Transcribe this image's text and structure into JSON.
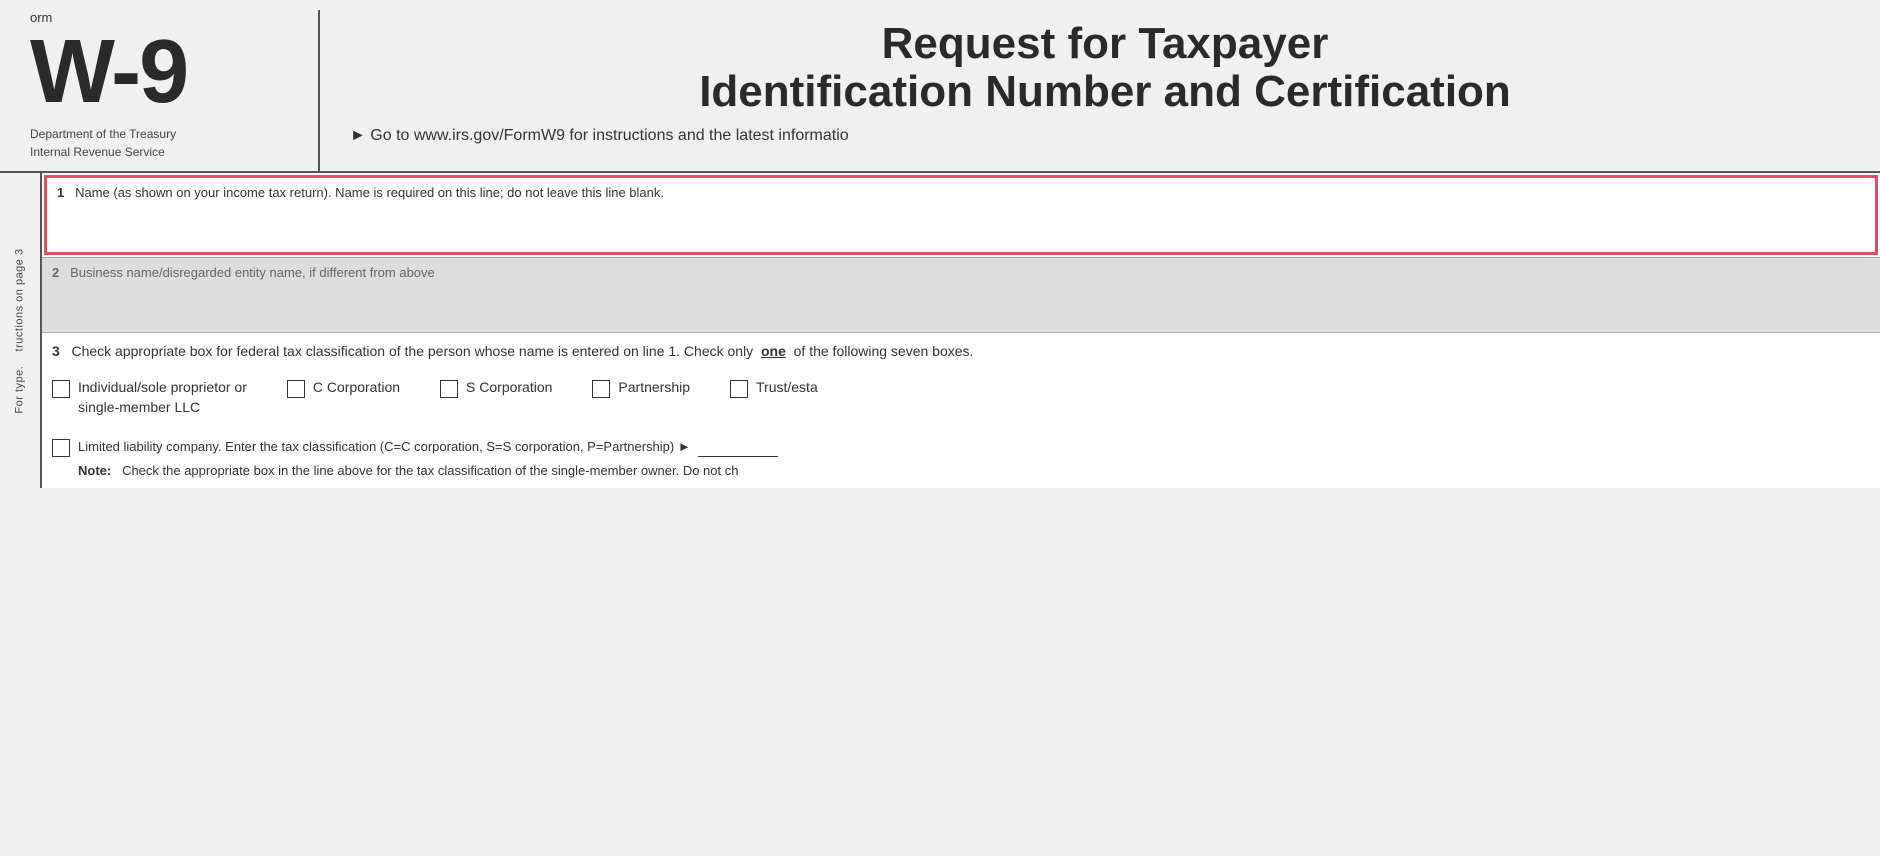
{
  "header": {
    "form_label": "orm",
    "form_number": "W-9",
    "dept_line1": "Department of the Treasury",
    "dept_line2": "Internal Revenue Service",
    "title_line1": "Request for Taxpayer",
    "title_line2": "Identification Number and Certification",
    "instruction": "► Go to www.irs.gov/FormW9 for instructions and the latest informatio"
  },
  "side_labels": {
    "line1": "For type.",
    "line2": "tructions on page 3"
  },
  "fields": {
    "field1": {
      "number": "1",
      "label": "Name (as shown on your income tax return). Name is required on this line; do not leave this line blank."
    },
    "field2": {
      "number": "2",
      "label": "Business name/disregarded entity name, if different from above"
    },
    "field3": {
      "number": "3",
      "label_start": "Check appropriate box for federal tax classification of the person whose name is entered on line 1. Check only",
      "label_one": "one",
      "label_end": "of the following seven boxes.",
      "checkboxes": [
        {
          "id": "cb1",
          "label_line1": "Individual/sole proprietor or",
          "label_line2": "single-member LLC"
        },
        {
          "id": "cb2",
          "label_line1": "C Corporation",
          "label_line2": ""
        },
        {
          "id": "cb3",
          "label_line1": "S Corporation",
          "label_line2": ""
        },
        {
          "id": "cb4",
          "label_line1": "Partnership",
          "label_line2": ""
        },
        {
          "id": "cb5",
          "label_line1": "Trust/esta",
          "label_line2": ""
        }
      ],
      "llc_label": "Limited liability company. Enter the tax classification (C=C corporation, S=S corporation, P=Partnership) ►",
      "note_label": "Note:",
      "note_text": "Check the appropriate box in the line above for the tax classification of the single-member owner.  Do not ch"
    }
  }
}
